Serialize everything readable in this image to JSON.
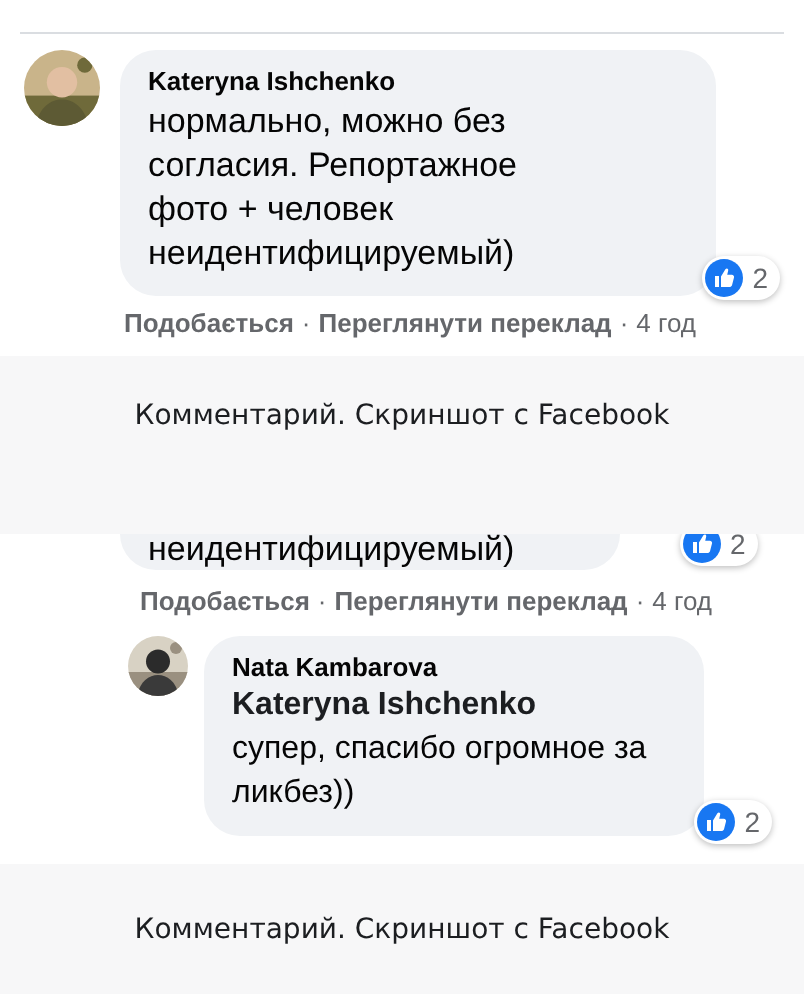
{
  "comment": {
    "author": "Kateryna Ishchenko",
    "text": "нормально, можно без согласия. Репортажное фото + человек неидентифицируемый)",
    "likes": "2",
    "actions": [
      "Подобається",
      "Переглянути переклад"
    ],
    "separator": "·",
    "time": "4 год"
  },
  "captions": [
    "Комментарий. Скриншот с Facebook",
    "Комментарий. Скриншот с Facebook"
  ],
  "repeat": {
    "text_tail": "неидентифицируемый)",
    "likes": "2",
    "actions": [
      "Подобається",
      "Переглянути переклад"
    ],
    "separator": "·",
    "time": "4 год"
  },
  "reply": {
    "author": "Nata Kambarova",
    "mention": "Kateryna Ishchenko",
    "text": "супер, спасибо огромное за ликбез))",
    "likes": "2"
  }
}
